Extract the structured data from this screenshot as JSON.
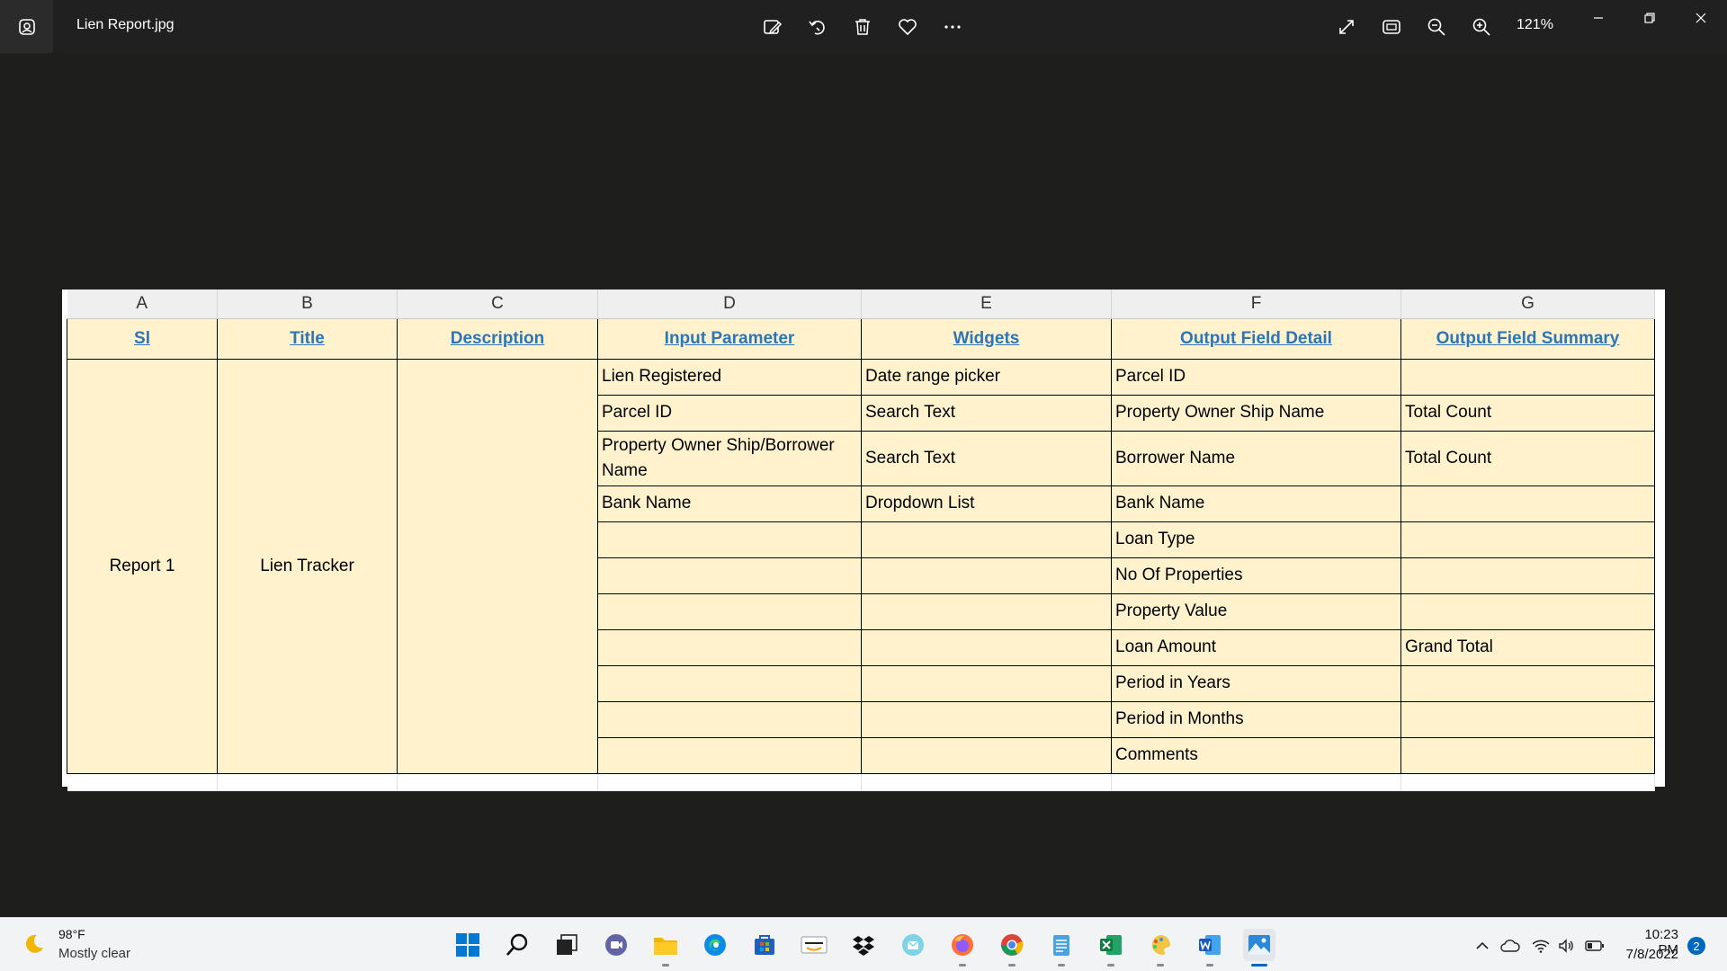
{
  "window": {
    "title": "Lien Report.jpg",
    "zoom": "121%"
  },
  "toolbar": {
    "icons": [
      "edit-image-icon",
      "rotate-icon",
      "delete-icon",
      "favorite-icon",
      "more-icon"
    ],
    "right_icons": [
      "fullscreen-icon",
      "fit-window-icon",
      "zoom-out-icon",
      "zoom-in-icon"
    ]
  },
  "sheet": {
    "column_letters": [
      "A",
      "B",
      "C",
      "D",
      "E",
      "F",
      "G"
    ],
    "headers": [
      "Sl",
      "Title",
      "Description",
      "Input Parameter",
      "Widgets",
      "Output Field Detail",
      "Output Field Summary"
    ],
    "sl": "Report 1",
    "title": "Lien Tracker",
    "description": "",
    "rows": [
      {
        "input": "Lien Registered",
        "widget": "Date range picker",
        "output": "Parcel ID",
        "summary": ""
      },
      {
        "input": "Parcel ID",
        "widget": "Search Text",
        "output": "Property Owner Ship Name",
        "summary": "Total Count"
      },
      {
        "input": "Property Owner Ship/Borrower Name",
        "widget": "Search Text",
        "output": "Borrower Name",
        "summary": "Total Count"
      },
      {
        "input": "Bank Name",
        "widget": "Dropdown List",
        "output": "Bank Name",
        "summary": ""
      },
      {
        "input": "",
        "widget": "",
        "output": "Loan Type",
        "summary": ""
      },
      {
        "input": "",
        "widget": "",
        "output": "No Of Properties",
        "summary": ""
      },
      {
        "input": "",
        "widget": "",
        "output": "Property Value",
        "summary": ""
      },
      {
        "input": "",
        "widget": "",
        "output": "Loan Amount",
        "summary": "Grand Total"
      },
      {
        "input": "",
        "widget": "",
        "output": "Period in Years",
        "summary": ""
      },
      {
        "input": "",
        "widget": "",
        "output": "Period in Months",
        "summary": ""
      },
      {
        "input": "",
        "widget": "",
        "output": "Comments",
        "summary": ""
      }
    ]
  },
  "taskbar": {
    "weather_temp": "98°F",
    "weather_desc": "Mostly clear",
    "apps": [
      "start-icon",
      "search-icon",
      "task-view-icon",
      "teams-chat-icon",
      "file-explorer-icon",
      "edge-icon",
      "store-icon",
      "amazon-icon",
      "dropbox-icon",
      "mail-icon",
      "firefox-icon",
      "chrome-icon",
      "notepad-icon",
      "excel-icon",
      "paint-icon",
      "word-icon",
      "photos-icon"
    ],
    "time": "10:23 PM",
    "date": "7/8/2022",
    "notification_count": "2"
  },
  "colors": {
    "header_text": "#2e75b6",
    "cell_fill": "#fff2cc",
    "accent": "#0067c0"
  }
}
